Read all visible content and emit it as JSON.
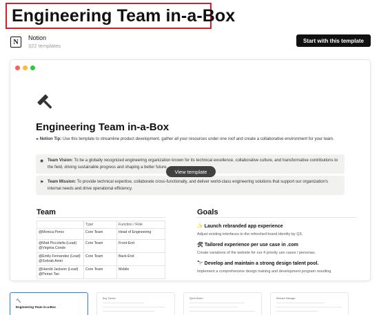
{
  "header": {
    "title": "Engineering Team in-a-Box",
    "creator_name": "Notion",
    "creator_count": "322 templates",
    "start_button": "Start with this template"
  },
  "preview": {
    "dot_colors": [
      "#ff5f57",
      "#febc2e",
      "#28c840"
    ],
    "doc_title": "Engineering Team in-a-Box",
    "tip_label": "Notion Tip:",
    "tip_text": "Use this template to streamline product development, gather all your resources under one roof and create a collaborative environment for your team.",
    "vision_label": "Team Vision:",
    "vision_text": "To be a globally recognized engineering organization known for its technical excellence, collaborative culture, and transformative contributions to the field, driving sustainable progress and shaping a better future.",
    "mission_label": "Team Mission:",
    "mission_text": "To provide technical expertise, collaborate cross-functionally, and deliver world-class engineering solutions that support our organization's internal needs and drive operational efficiency.",
    "view_button": "View template",
    "team_heading": "Team",
    "goals_heading": "Goals",
    "team_table": {
      "headers": [
        "",
        "Type",
        "Function / Role"
      ],
      "rows": [
        {
          "name": "@Monica Perez",
          "name2": "",
          "type": "Core Team",
          "role": "Head of Engineering"
        },
        {
          "name": "@Matt Piccolella (Lead)",
          "name2": "@Virginia Conde",
          "type": "Core Team",
          "role": "Front-End"
        },
        {
          "name": "@Emily Fernandez (Lead)",
          "name2": "@Sohrab Amiri",
          "type": "Core Team",
          "role": "Back-End"
        },
        {
          "name": "@Harold Jackson (Lead)",
          "name2": "@Peiran Tan",
          "type": "Core Team",
          "role": "Mobile"
        }
      ]
    },
    "goals": [
      {
        "icon": "✨",
        "title": "Launch rebranded app experience",
        "text": "Adjust existing interfaces to the refreshed brand identity by Q3."
      },
      {
        "icon": "🛠",
        "title": "Tailored experience per use case in .com",
        "text": "Create variations of the website for our 4 priority use cases / personas."
      },
      {
        "icon": "🔭",
        "title": "Develop and maintain a strong design talent pool.",
        "text": "Implement a comprehensive design training and development program resulting"
      }
    ]
  },
  "thumbnails": [
    {
      "label": "Engineering Team in-a-Box",
      "icon": "🔨"
    },
    {
      "label": "Bug Tracker",
      "icon": ""
    },
    {
      "label": "Sprint Board",
      "icon": ""
    },
    {
      "label": "Release Manager",
      "icon": ""
    }
  ]
}
